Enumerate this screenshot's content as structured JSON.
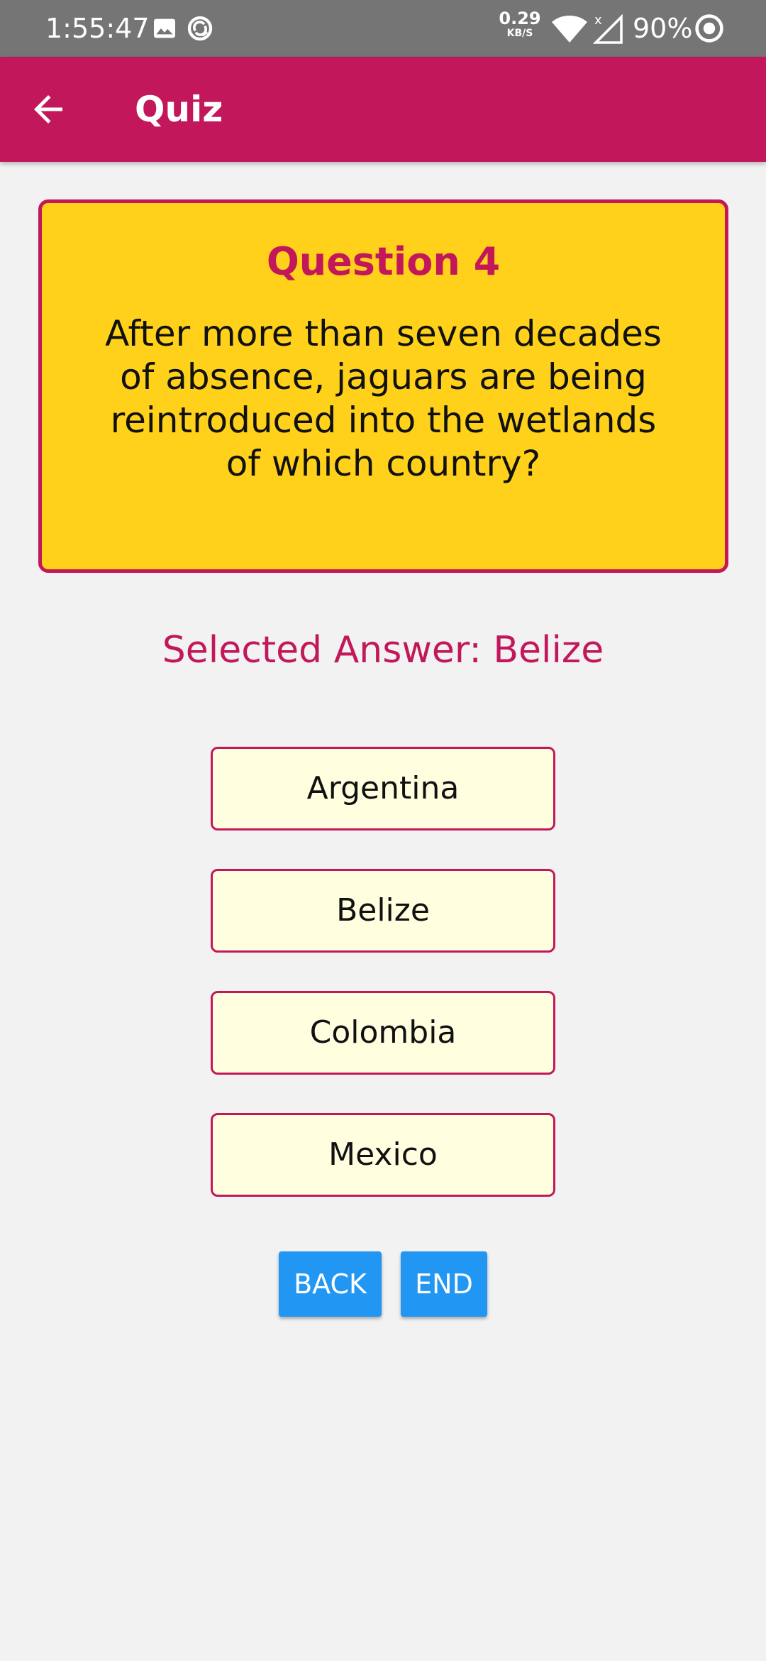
{
  "status_bar": {
    "time": "1:55:47",
    "speed_value": "0.29",
    "speed_unit": "KB/S",
    "battery": "90%",
    "icons": [
      "image-icon",
      "sync-icon",
      "wifi-icon",
      "signal-icon",
      "battery-icon"
    ]
  },
  "app_bar": {
    "title": "Quiz",
    "back_icon": "back-arrow-icon",
    "color": "#c2185b"
  },
  "question": {
    "number_label": "Question 4",
    "text": "After more than seven decades of absence, jaguars are being reintroduced into the wetlands of which country?",
    "card_color": "#ffd11a"
  },
  "selected_answer": "Selected Answer: Belize",
  "options": [
    "Argentina",
    "Belize",
    "Colombia",
    "Mexico"
  ],
  "buttons": {
    "back_label": "BACK",
    "end_label": "END",
    "color": "#2196f3"
  }
}
